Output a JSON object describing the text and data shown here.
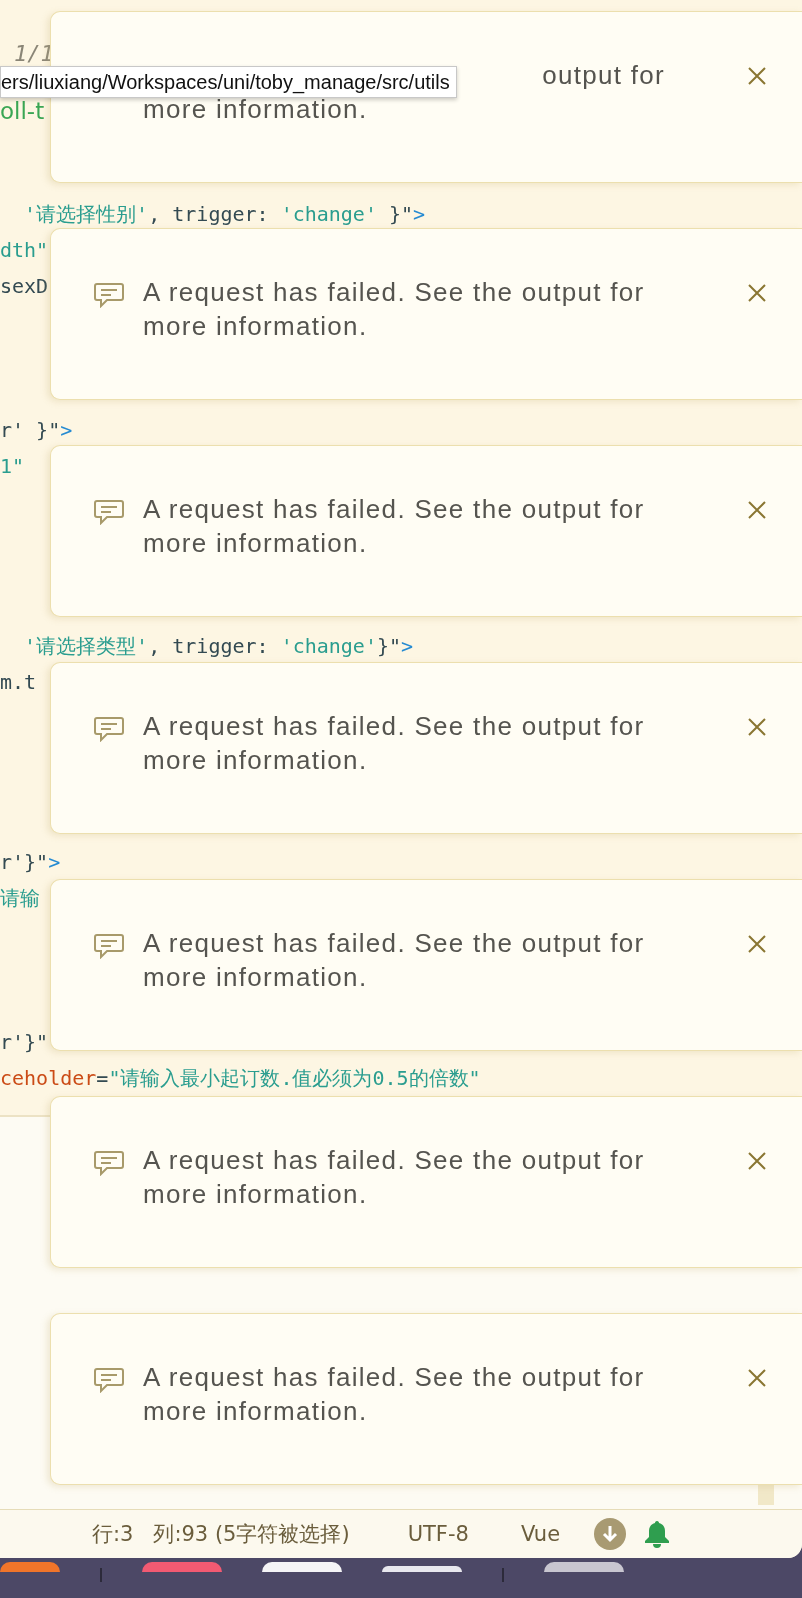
{
  "find_bar": {
    "match_count": "1/1"
  },
  "tabs": [
    {
      "label": "oll-t",
      "selected": true
    }
  ],
  "tooltip": "ers/liuxiang/Workspaces/uni/toby_manage/src/utils",
  "code_lines": [
    {
      "segments": [
        {
          "kind": "string",
          "text": "  '请选择性别'"
        },
        {
          "kind": "plain",
          "text": ", trigger: "
        },
        {
          "kind": "string",
          "text": "'change'"
        },
        {
          "kind": "plain",
          "text": " }\""
        },
        {
          "kind": "tag",
          "text": ">"
        }
      ]
    },
    {
      "segments": [
        {
          "kind": "string",
          "text": "dth\""
        }
      ]
    },
    {
      "segments": [
        {
          "kind": "plain",
          "text": "sexD"
        }
      ]
    },
    {
      "segments": [
        {
          "kind": "plain",
          "text": "r' }\""
        },
        {
          "kind": "tag",
          "text": ">"
        }
      ]
    },
    {
      "segments": [
        {
          "kind": "string",
          "text": "1\""
        }
      ]
    },
    {
      "segments": [
        {
          "kind": "string",
          "text": "  '请选择类型'"
        },
        {
          "kind": "plain",
          "text": ", trigger: "
        },
        {
          "kind": "string",
          "text": "'change'"
        },
        {
          "kind": "plain",
          "text": "}\""
        },
        {
          "kind": "tag",
          "text": ">"
        }
      ]
    },
    {
      "segments": [
        {
          "kind": "plain",
          "text": "m.t"
        }
      ]
    },
    {
      "segments": [
        {
          "kind": "plain",
          "text": "r'}\""
        },
        {
          "kind": "tag",
          "text": ">"
        }
      ]
    },
    {
      "segments": [
        {
          "kind": "string",
          "text": "请输"
        }
      ]
    },
    {
      "segments": [
        {
          "kind": "plain",
          "text": "r'}\""
        }
      ]
    },
    {
      "segments": [
        {
          "kind": "attr",
          "text": "ceholder"
        },
        {
          "kind": "plain",
          "text": "="
        },
        {
          "kind": "string",
          "text": "\"请输入最小起订数.值必须为0.5的倍数\""
        }
      ]
    }
  ],
  "notifications": [
    {
      "kind": "partial",
      "lines": [
        "output for",
        "more information."
      ]
    },
    {
      "lines": [
        "A request has failed. See the output for",
        "more information."
      ]
    },
    {
      "lines": [
        "A request has failed. See the output for",
        "more information."
      ]
    },
    {
      "lines": [
        "A request has failed. See the output for",
        "more information."
      ]
    },
    {
      "lines": [
        "A request has failed. See the output for",
        "more information."
      ]
    },
    {
      "lines": [
        "A request has failed. See the output for",
        "more information."
      ]
    },
    {
      "lines": [
        "A request has failed. See the output for",
        "more information."
      ]
    }
  ],
  "status_bar": {
    "line": "行:3",
    "column": "列:93 (5字符被选择)",
    "encoding": "UTF-8",
    "language": "Vue"
  }
}
